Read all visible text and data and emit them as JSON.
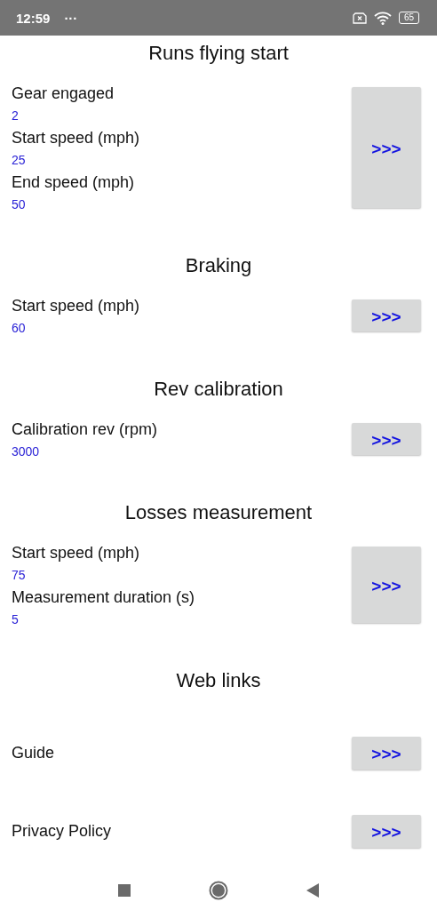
{
  "status_bar": {
    "time": "12:59",
    "more": "···",
    "battery": "65"
  },
  "sections": [
    {
      "kind": "form",
      "title": "Runs flying start",
      "fields": [
        {
          "label": "Gear engaged",
          "value": "2"
        },
        {
          "label": "Start speed (mph)",
          "value": "25"
        },
        {
          "label": "End speed (mph)",
          "value": "50"
        }
      ],
      "button": ">>>"
    },
    {
      "kind": "form",
      "title": "Braking",
      "fields": [
        {
          "label": "Start speed (mph)",
          "value": "60"
        }
      ],
      "button": ">>>"
    },
    {
      "kind": "form",
      "title": "Rev calibration",
      "fields": [
        {
          "label": "Calibration rev (rpm)",
          "value": "3000"
        }
      ],
      "button": ">>>"
    },
    {
      "kind": "form",
      "title": "Losses measurement",
      "fields": [
        {
          "label": "Start speed (mph)",
          "value": "75"
        },
        {
          "label": "Measurement duration (s)",
          "value": "5"
        }
      ],
      "button": ">>>"
    },
    {
      "kind": "links",
      "title": "Web links",
      "links": [
        {
          "label": "Guide",
          "button": ">>>"
        },
        {
          "label": "Privacy Policy",
          "button": ">>>"
        }
      ]
    }
  ]
}
